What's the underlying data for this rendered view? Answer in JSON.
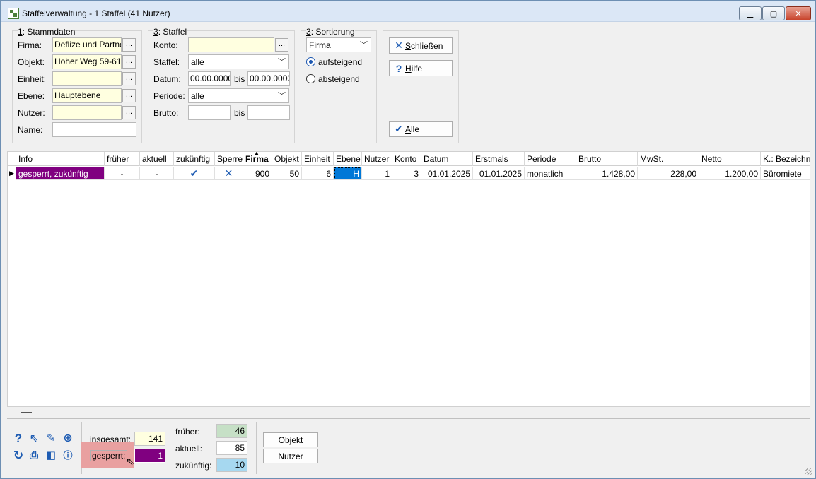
{
  "window": {
    "title": "Staffelverwaltung - 1 Staffel (41 Nutzer)",
    "min_symbol": "▁",
    "max_symbol": "▢",
    "close_symbol": "✕"
  },
  "stammdaten": {
    "title_num": "1",
    "title_rest": ": Stammdaten",
    "firma_label": "Firma:",
    "firma_value": "Deflize und Partne",
    "objekt_label": "Objekt:",
    "objekt_value": "Hoher Weg 59-61,",
    "einheit_label": "Einheit:",
    "einheit_value": "",
    "ebene_label": "Ebene:",
    "ebene_value": "Hauptebene",
    "nutzer_label": "Nutzer:",
    "nutzer_value": "",
    "name_label": "Name:",
    "name_value": "",
    "dots": "..."
  },
  "staffel": {
    "title_num": "3",
    "title_rest": ": Staffel",
    "konto_label": "Konto:",
    "konto_value": "",
    "staffel_label": "Staffel:",
    "staffel_value": "alle",
    "datum_label": "Datum:",
    "datum_from": "00.00.0000",
    "datum_bis": "bis",
    "datum_to": "00.00.0000",
    "periode_label": "Periode:",
    "periode_value": "alle",
    "brutto_label": "Brutto:",
    "brutto_from": "",
    "brutto_bis": "bis",
    "brutto_to": "",
    "dots": "..."
  },
  "sortierung": {
    "title_num": "3",
    "title_rest": ": Sortierung",
    "sort_value": "Firma",
    "asc_label": "aufsteigend",
    "desc_label": "absteigend",
    "selected": "aufsteigend"
  },
  "actions": {
    "close_label_u": "S",
    "close_label_rest": "chließen",
    "help_label_u": "H",
    "help_label_rest": "ilfe",
    "all_label_u": "A",
    "all_label_rest": "lle"
  },
  "grid": {
    "columns": [
      "Info",
      "früher",
      "aktuell",
      "zukünftig",
      "Sperre",
      "Firma",
      "Objekt",
      "Einheit",
      "Ebene",
      "Nutzer",
      "Konto",
      "Datum",
      "Erstmals",
      "Periode",
      "Brutto",
      "MwSt.",
      "Netto",
      "K.: Bezeichnu"
    ],
    "sorted_column": "Firma",
    "rows": [
      {
        "info": "gesperrt, zukünftig",
        "frueher": "-",
        "aktuell": "-",
        "zukuenftig": "✔",
        "sperre": "✕",
        "firma": "900",
        "objekt": "50",
        "einheit": "6",
        "ebene": "H",
        "nutzer": "1",
        "konto": "3",
        "datum": "01.01.2025",
        "erstmals": "01.01.2025",
        "periode": "monatlich",
        "brutto": "1.428,00",
        "mwst": "228,00",
        "netto": "1.200,00",
        "bezeichnung": "Büromiete"
      }
    ]
  },
  "stats": {
    "insgesamt_label": "insgesamt:",
    "insgesamt_value": "141",
    "gesperrt_label": "gesperrt:",
    "gesperrt_value": "1",
    "frueher_label": "früher:",
    "frueher_value": "46",
    "aktuell_label": "aktuell:",
    "aktuell_value": "85",
    "zukuenftig_label": "zukünftig:",
    "zukuenftig_value": "10"
  },
  "bottom_buttons": {
    "objekt": "Objekt",
    "nutzer": "Nutzer"
  },
  "colors": {
    "gesperrt": "#800080",
    "frueher": "#c6e0c6",
    "aktuell": "#ffffff",
    "zukuenftig": "#a6d8f0",
    "insgesamt": "#ffffe0",
    "highlight": "#e9a0a0",
    "accent": "#1e5cb3"
  }
}
